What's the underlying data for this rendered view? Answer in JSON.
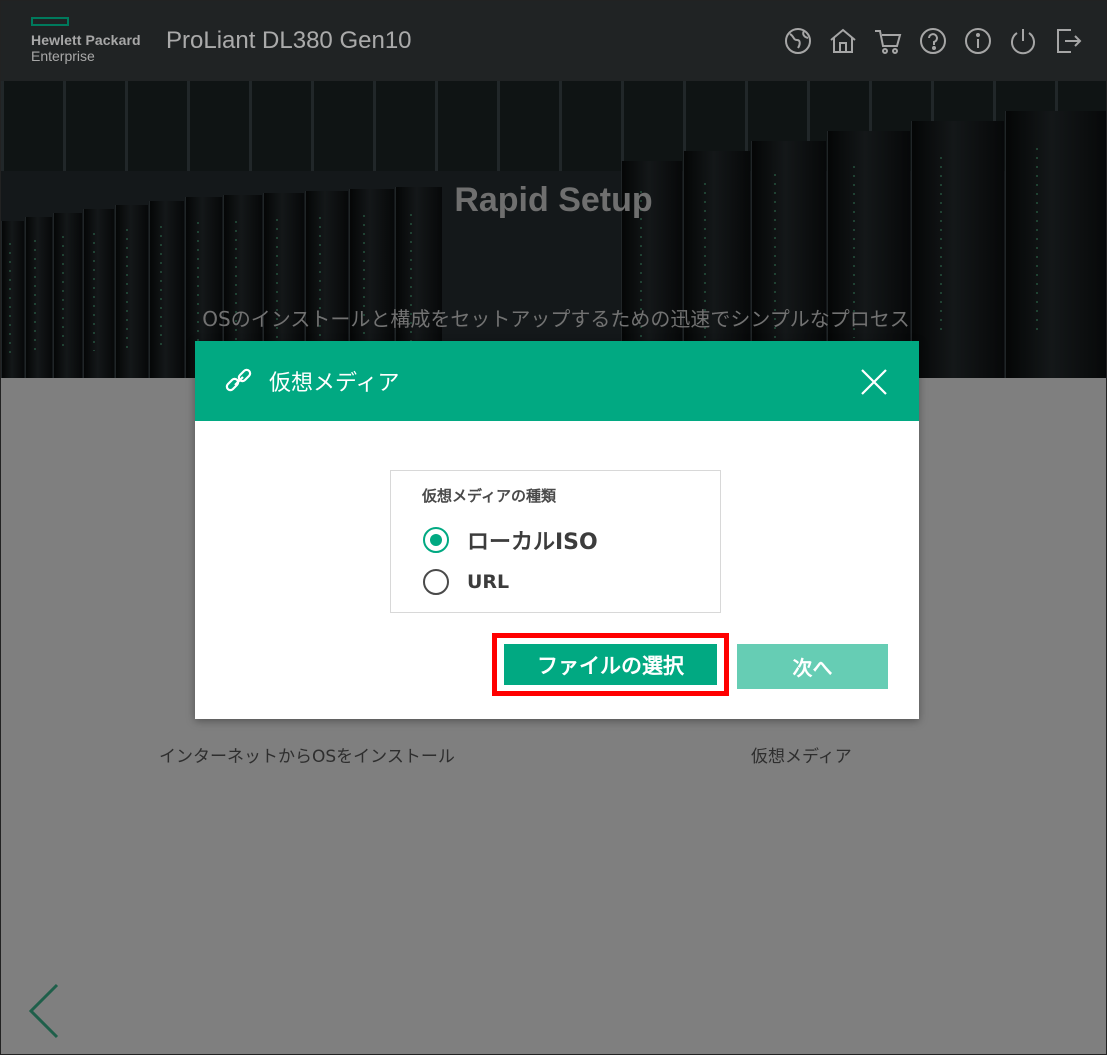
{
  "header": {
    "brand_line1": "Hewlett Packard",
    "brand_line2": "Enterprise",
    "product": "ProLiant DL380 Gen10",
    "icons": [
      "globe-icon",
      "home-icon",
      "cart-icon",
      "help-icon",
      "info-icon",
      "power-icon",
      "logout-icon"
    ]
  },
  "hero": {
    "title": "Rapid Setup",
    "subtitle": "OSのインストールと構成をセットアップするための迅速でシンプルなプロセス"
  },
  "cards": {
    "left_label": "インターネットからOSをインストール",
    "right_label": "仮想メディア"
  },
  "modal": {
    "title": "仮想メディア",
    "fieldset_legend": "仮想メディアの種類",
    "options": [
      {
        "label": "ローカルISO",
        "selected": true
      },
      {
        "label": "URL",
        "selected": false
      }
    ],
    "select_file_button": "ファイルの選択",
    "next_button": "次へ"
  },
  "colors": {
    "accent": "#01a982",
    "accent_disabled": "#66cdb4",
    "highlight": "#ff0000"
  }
}
